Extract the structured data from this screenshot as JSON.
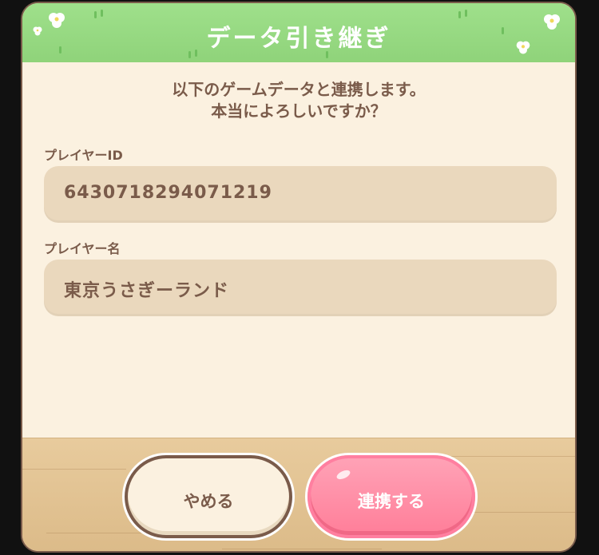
{
  "dialog": {
    "title": "データ引き継ぎ",
    "message_line1": "以下のゲームデータと連携します。",
    "message_line2": "本当によろしいですか？"
  },
  "fields": {
    "player_id": {
      "label": "プレイヤーID",
      "value": "6430718294071219"
    },
    "player_name": {
      "label": "プレイヤー名",
      "value": "東京うさぎーランド"
    }
  },
  "buttons": {
    "cancel_label": "やめる",
    "confirm_label": "連携する"
  },
  "colors": {
    "header_green": "#8fd37a",
    "text_brown": "#7a5b4a",
    "panel_cream": "#fbf1e0",
    "field_tan": "#ead8bd",
    "confirm_pink": "#ff7e99"
  },
  "icons": [
    "flower-icon"
  ]
}
